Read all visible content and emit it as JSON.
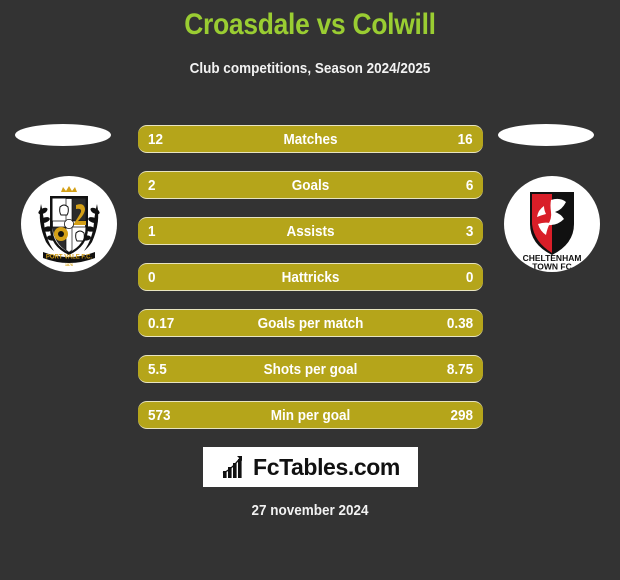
{
  "header": {
    "title": "Croasdale vs Colwill",
    "subtitle": "Club competitions, Season 2024/2025",
    "title_color": "#9ACD32"
  },
  "teams": {
    "home": {
      "badge_name": "port-vale-fc-badge",
      "badge_text_line1": "PORT VALE F.C.",
      "badge_text_line2": "1876"
    },
    "away": {
      "badge_name": "cheltenham-town-fc-badge",
      "badge_text_line1": "CHELTENHAM",
      "badge_text_line2": "TOWN FC"
    }
  },
  "stats": {
    "bar_color": "#B5A51A",
    "rows": [
      {
        "label": "Matches",
        "home": "12",
        "away": "16"
      },
      {
        "label": "Goals",
        "home": "2",
        "away": "6"
      },
      {
        "label": "Assists",
        "home": "1",
        "away": "3"
      },
      {
        "label": "Hattricks",
        "home": "0",
        "away": "0"
      },
      {
        "label": "Goals per match",
        "home": "0.17",
        "away": "0.38"
      },
      {
        "label": "Shots per goal",
        "home": "5.5",
        "away": "8.75"
      },
      {
        "label": "Min per goal",
        "home": "573",
        "away": "298"
      }
    ]
  },
  "footer": {
    "logo_text": "FcTables.com",
    "logo_icon": "bar-chart-growth-icon",
    "date": "27 november 2024"
  }
}
